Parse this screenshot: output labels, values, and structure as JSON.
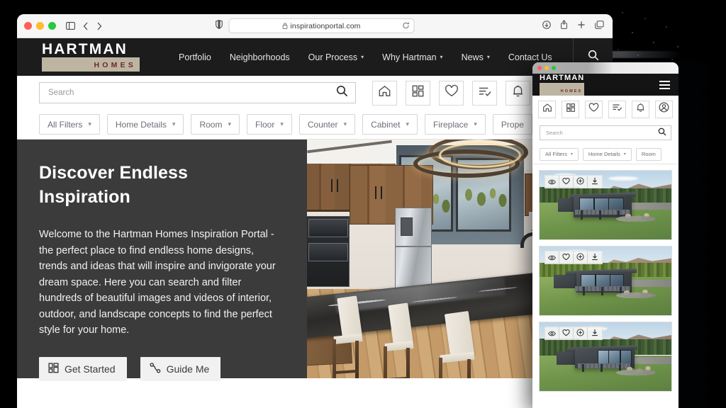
{
  "browser": {
    "url": "inspirationportal.com",
    "lock_icon": "lock-icon",
    "reload_icon": "reload-icon",
    "back_icon": "back-icon",
    "forward_icon": "forward-icon",
    "sidebar_icon": "sidebar-icon",
    "shield_icon": "privacy-shield-icon",
    "downloads_icon": "downloads-icon",
    "share_icon": "share-icon",
    "newtab_icon": "new-tab-icon",
    "tabs_icon": "tab-overview-icon",
    "traffic_lights": [
      "close",
      "minimize",
      "maximize"
    ]
  },
  "site": {
    "logo": {
      "top": "HARTMAN",
      "sub": "HOMES",
      "bar_color": "#bdb5a2",
      "sub_color": "#6d2a2a"
    },
    "nav": [
      {
        "label": "Portfolio",
        "has_chevron": false
      },
      {
        "label": "Neighborhoods",
        "has_chevron": false
      },
      {
        "label": "Our Process",
        "has_chevron": true
      },
      {
        "label": "Why Hartman",
        "has_chevron": true
      },
      {
        "label": "News",
        "has_chevron": true
      },
      {
        "label": "Contact Us",
        "has_chevron": false
      }
    ],
    "nav_search_icon": "search-icon",
    "header_bg": "#1c1c1c"
  },
  "toolbar": {
    "search_placeholder": "Search",
    "search_icon": "search-icon",
    "icons": [
      {
        "name": "home-icon",
        "label": "Home"
      },
      {
        "name": "dashboard-grid-icon",
        "label": "Dashboard"
      },
      {
        "name": "heart-icon",
        "label": "Favorites"
      },
      {
        "name": "list-check-icon",
        "label": "My Lists"
      },
      {
        "name": "bell-icon",
        "label": "Notifications"
      }
    ]
  },
  "filters": [
    {
      "label": "All Filters"
    },
    {
      "label": "Home Details"
    },
    {
      "label": "Room"
    },
    {
      "label": "Floor"
    },
    {
      "label": "Counter"
    },
    {
      "label": "Cabinet"
    },
    {
      "label": "Fireplace"
    },
    {
      "label": "Prope"
    }
  ],
  "hero": {
    "title": "Discover Endless Inspiration",
    "body": "Welcome to the Hartman Homes Inspiration Portal - the perfect place to find endless home designs, trends and ideas that will inspire and invigorate your dream space. Here you can search and filter hundreds of beautiful images and videos of interior, outdoor, and landscape concepts to find the perfect style for your home.",
    "buttons": [
      {
        "label": "Get Started",
        "icon": "dashboard-grid-icon"
      },
      {
        "label": "Guide Me",
        "icon": "route-guide-icon"
      }
    ],
    "bg_color": "#3b3b3b",
    "image_alt": "luxury kitchen with wood cabinets, stone island and barstools"
  },
  "tablet": {
    "logo": {
      "top": "HARTMAN",
      "sub": "HOMES"
    },
    "menu_icon": "hamburger-menu-icon",
    "icons": [
      {
        "name": "home-icon",
        "label": "Home"
      },
      {
        "name": "dashboard-grid-icon",
        "label": "Dashboard"
      },
      {
        "name": "heart-icon",
        "label": "Favorites"
      },
      {
        "name": "list-check-icon",
        "label": "My Lists"
      },
      {
        "name": "bell-icon",
        "label": "Notifications"
      },
      {
        "name": "user-account-icon",
        "label": "Account"
      }
    ],
    "search_placeholder": "Search",
    "search_icon": "search-icon",
    "filters": [
      {
        "label": "All Filters"
      },
      {
        "label": "Home Details"
      },
      {
        "label": "Room"
      }
    ],
    "card_actions": [
      {
        "name": "eye-view-icon",
        "label": "View"
      },
      {
        "name": "heart-icon",
        "label": "Favorite"
      },
      {
        "name": "plus-add-icon",
        "label": "Add"
      },
      {
        "name": "download-icon",
        "label": "Download"
      }
    ],
    "cards": [
      {
        "image_alt": "modern mountain home exterior with glass walls and green lawn"
      },
      {
        "image_alt": "modern mountain home exterior with deck and aspen forest"
      },
      {
        "image_alt": "modern mountain home exterior with stone landscaping"
      }
    ],
    "traffic_lights": [
      "close",
      "minimize",
      "maximize"
    ]
  }
}
